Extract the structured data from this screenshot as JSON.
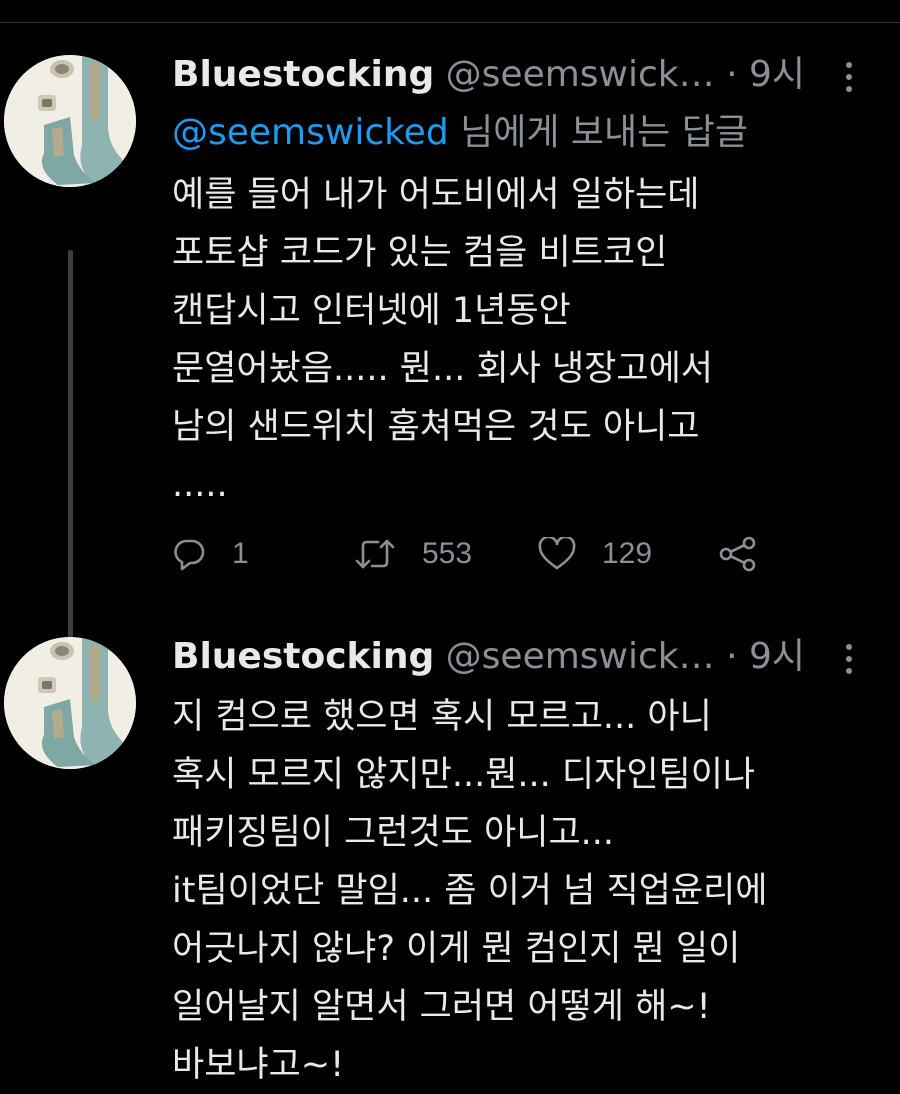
{
  "colors": {
    "background": "#000000",
    "text": "#e7e9ea",
    "secondary_text": "#8b9096",
    "link": "#1d9bf0",
    "divider": "#2f3336"
  },
  "tweets": [
    {
      "author": {
        "name": "Bluestocking",
        "handle": "@seemswick…",
        "avatar_icon": "avatar-image"
      },
      "separator": "·",
      "time": "9시",
      "reply_to": {
        "mention": "@seemswicked",
        "suffix": " 님에게 보내는 답글"
      },
      "text": "예를 들어 내가 어도비에서 일하는데\n포토샵 코드가 있는 컴을 비트코인\n캔답시고 인터넷에 1년동안\n문열어놨음..... 뭔... 회사 냉장고에서\n남의 샌드위치 훔쳐먹은 것도 아니고\n.....",
      "actions": {
        "reply": {
          "icon": "reply-icon",
          "count": "1"
        },
        "retweet": {
          "icon": "retweet-icon",
          "count": "553"
        },
        "like": {
          "icon": "heart-icon",
          "count": "129"
        },
        "share": {
          "icon": "share-icon"
        }
      }
    },
    {
      "author": {
        "name": "Bluestocking",
        "handle": "@seemswick…",
        "avatar_icon": "avatar-image"
      },
      "separator": "·",
      "time": "9시",
      "text": "지 컴으로 했으면 혹시 모르고... 아니\n혹시 모르지 않지만...뭔... 디자인팀이나\n패키징팀이 그런것도 아니고...\nit팀이었단 말임... 좀 이거 넘 직업윤리에\n어긋나지 않냐? 이게 뭔 컴인지 뭔 일이\n일어날지 알면서 그러면 어떻게 해~!\n바보냐고~!"
    }
  ]
}
